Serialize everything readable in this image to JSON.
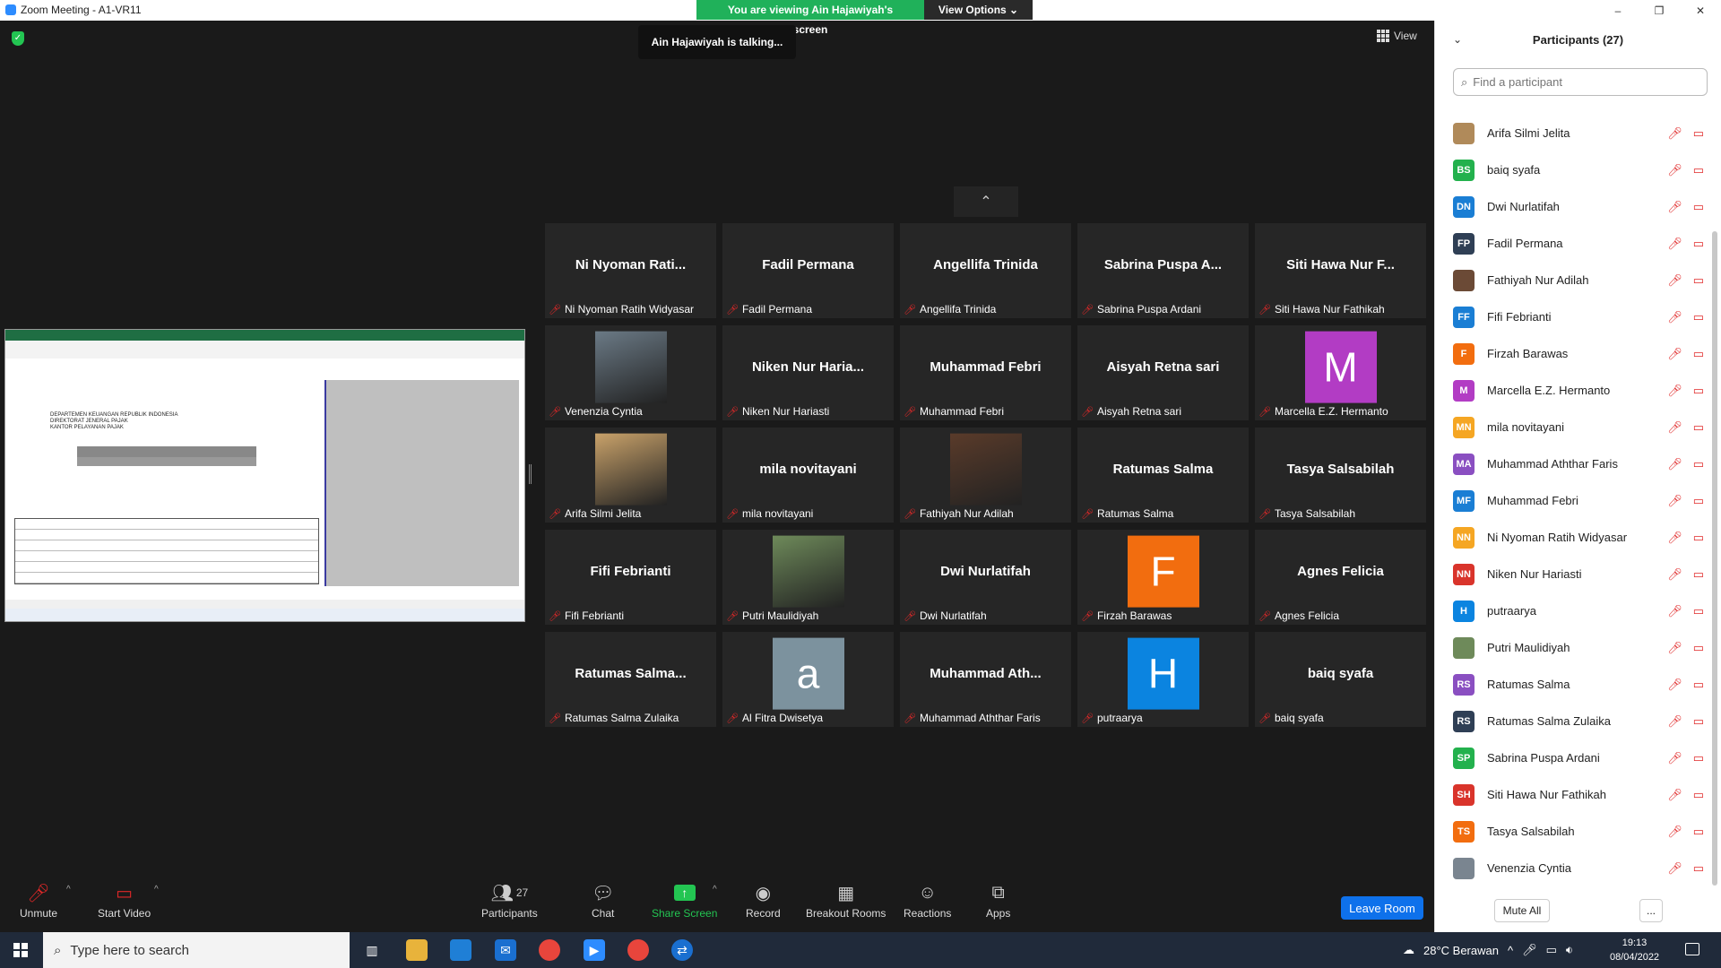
{
  "window": {
    "title": "Zoom Meeting - A1-VR11",
    "minimize": "–",
    "restore": "❐",
    "close": "✕"
  },
  "banner": {
    "viewing": "You are viewing Ain Hajawiyah's screen",
    "view_options": "View Options ⌄"
  },
  "talking": "Ain Hajawiyah is talking...",
  "view_label": "View",
  "shared_screen": {
    "doc_header": "DEPARTEMEN KEUANGAN REPUBLIK INDONESIA\nDIREKTORAT JENERAL PAJAK\nKANTOR PELAYANAN PAJAK",
    "form_title": "BUKTI PEMOTONGAN PPh PASAL 23"
  },
  "collapse_icon": "⌃",
  "gallery": [
    {
      "display": "Ni Nyoman Rati...",
      "label": "Ni Nyoman Ratih Widyasar",
      "kind": "name"
    },
    {
      "display": "Fadil Permana",
      "label": "Fadil Permana",
      "kind": "name"
    },
    {
      "display": "Angellifa Trinida",
      "label": "Angellifa Trinida",
      "kind": "name"
    },
    {
      "display": "Sabrina Puspa A...",
      "label": "Sabrina Puspa Ardani",
      "kind": "name"
    },
    {
      "display": "Siti Hawa Nur F...",
      "label": "Siti Hawa Nur Fathikah",
      "kind": "name"
    },
    {
      "display": "",
      "label": "Venenzia Cyntia",
      "kind": "photo",
      "color": "#6b7a86"
    },
    {
      "display": "Niken Nur Haria...",
      "label": "Niken Nur Hariasti",
      "kind": "name"
    },
    {
      "display": "Muhammad Febri",
      "label": "Muhammad Febri",
      "kind": "name"
    },
    {
      "display": "Aisyah Retna sari",
      "label": "Aisyah Retna sari",
      "kind": "name"
    },
    {
      "display": "M",
      "label": "Marcella E.Z. Hermanto",
      "kind": "letter",
      "color": "#b23cc4"
    },
    {
      "display": "",
      "label": "Arifa Silmi Jelita",
      "kind": "photo",
      "color": "#c9a26a"
    },
    {
      "display": "mila novitayani",
      "label": "mila novitayani",
      "kind": "name"
    },
    {
      "display": "",
      "label": "Fathiyah Nur Adilah",
      "kind": "photo",
      "color": "#5a3b2a"
    },
    {
      "display": "Ratumas Salma",
      "label": "Ratumas Salma",
      "kind": "name"
    },
    {
      "display": "Tasya Salsabilah",
      "label": "Tasya Salsabilah",
      "kind": "name"
    },
    {
      "display": "Fifi Febrianti",
      "label": "Fifi Febrianti",
      "kind": "name"
    },
    {
      "display": "",
      "label": "Putri Maulidiyah",
      "kind": "photo",
      "color": "#6e8a5a"
    },
    {
      "display": "Dwi Nurlatifah",
      "label": "Dwi Nurlatifah",
      "kind": "name"
    },
    {
      "display": "F",
      "label": "Firzah Barawas",
      "kind": "letter",
      "color": "#f26d0f"
    },
    {
      "display": "Agnes Felicia",
      "label": "Agnes Felicia",
      "kind": "name"
    },
    {
      "display": "Ratumas Salma...",
      "label": "Ratumas Salma Zulaika",
      "kind": "name"
    },
    {
      "display": "a",
      "label": "Al Fitra Dwisetya",
      "kind": "letter",
      "color": "#7c929e"
    },
    {
      "display": "Muhammad Ath...",
      "label": "Muhammad Aththar Faris",
      "kind": "name"
    },
    {
      "display": "H",
      "label": "putraarya",
      "kind": "letter",
      "color": "#0b84e0"
    },
    {
      "display": "baiq syafa",
      "label": "baiq syafa",
      "kind": "name"
    }
  ],
  "toolbar": {
    "unmute": "Unmute",
    "start_video": "Start Video",
    "participants": "Participants",
    "participants_count": "27",
    "chat": "Chat",
    "share_screen": "Share Screen",
    "record": "Record",
    "breakout": "Breakout Rooms",
    "reactions": "Reactions",
    "apps": "Apps",
    "leave": "Leave Room"
  },
  "panel": {
    "title": "Participants (27)",
    "search_placeholder": "Find a participant",
    "mute_all": "Mute All",
    "more": "...",
    "participants": [
      {
        "initials": "",
        "name": "Arifa Silmi Jelita",
        "color": "#b08a5a"
      },
      {
        "initials": "BS",
        "name": "baiq syafa",
        "color": "#23b14d"
      },
      {
        "initials": "DN",
        "name": "Dwi Nurlatifah",
        "color": "#1a7ed4"
      },
      {
        "initials": "FP",
        "name": "Fadil Permana",
        "color": "#2f3f55"
      },
      {
        "initials": "",
        "name": "Fathiyah Nur Adilah",
        "color": "#6b4a36"
      },
      {
        "initials": "FF",
        "name": "Fifi Febrianti",
        "color": "#1a7ed4"
      },
      {
        "initials": "F",
        "name": "Firzah Barawas",
        "color": "#f26d0f"
      },
      {
        "initials": "M",
        "name": "Marcella E.Z. Hermanto",
        "color": "#b23cc4"
      },
      {
        "initials": "MN",
        "name": "mila novitayani",
        "color": "#f5a623"
      },
      {
        "initials": "MA",
        "name": "Muhammad Aththar Faris",
        "color": "#8a4fc1"
      },
      {
        "initials": "MF",
        "name": "Muhammad Febri",
        "color": "#1a7ed4"
      },
      {
        "initials": "NN",
        "name": "Ni Nyoman Ratih Widyasar",
        "color": "#f5a623"
      },
      {
        "initials": "NN",
        "name": "Niken Nur Hariasti",
        "color": "#d9342b"
      },
      {
        "initials": "H",
        "name": "putraarya",
        "color": "#0b84e0"
      },
      {
        "initials": "",
        "name": "Putri Maulidiyah",
        "color": "#6e8a5a"
      },
      {
        "initials": "RS",
        "name": "Ratumas Salma",
        "color": "#8a4fc1"
      },
      {
        "initials": "RS",
        "name": "Ratumas Salma Zulaika",
        "color": "#2f3f55"
      },
      {
        "initials": "SP",
        "name": "Sabrina Puspa Ardani",
        "color": "#23b14d"
      },
      {
        "initials": "SH",
        "name": "Siti Hawa Nur Fathikah",
        "color": "#d9342b"
      },
      {
        "initials": "TS",
        "name": "Tasya Salsabilah",
        "color": "#f26d0f"
      },
      {
        "initials": "",
        "name": "Venenzia Cyntia",
        "color": "#7a8590"
      }
    ]
  },
  "taskbar": {
    "search_placeholder": "Type here to search",
    "weather": "28°C Berawan",
    "time": "19:13",
    "date": "08/04/2022"
  }
}
